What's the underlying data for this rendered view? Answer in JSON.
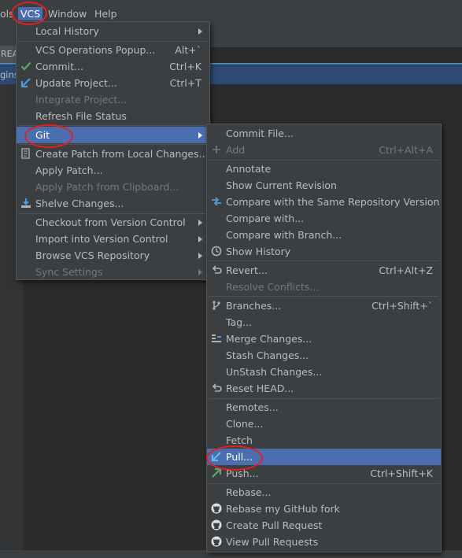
{
  "menubar": {
    "items": [
      "ols",
      "VCS",
      "Window",
      "Help"
    ]
  },
  "background": {
    "tab_text": "REA",
    "row_text": "gins"
  },
  "vcs_menu": {
    "items": [
      {
        "label": "Local History",
        "has_submenu": true
      },
      {
        "label": "VCS Operations Popup...",
        "shortcut": "Alt+`"
      },
      {
        "label": "Commit...",
        "shortcut": "Ctrl+K",
        "icon": "check-icon"
      },
      {
        "label": "Update Project...",
        "shortcut": "Ctrl+T",
        "icon": "update-arrow-icon"
      },
      {
        "label": "Integrate Project...",
        "disabled": true
      },
      {
        "label": "Refresh File Status"
      },
      {
        "label": "Git",
        "has_submenu": true,
        "selected": true
      },
      {
        "label": "Create Patch from Local Changes...",
        "icon": "patch-icon"
      },
      {
        "label": "Apply Patch..."
      },
      {
        "label": "Apply Patch from Clipboard...",
        "disabled": true
      },
      {
        "label": "Shelve Changes...",
        "icon": "shelve-icon"
      },
      {
        "label": "Checkout from Version Control",
        "has_submenu": true
      },
      {
        "label": "Import into Version Control",
        "has_submenu": true
      },
      {
        "label": "Browse VCS Repository",
        "has_submenu": true
      },
      {
        "label": "Sync Settings",
        "has_submenu": true,
        "disabled": true
      }
    ]
  },
  "git_menu": {
    "items": [
      {
        "label": "Commit File..."
      },
      {
        "label": "Add",
        "shortcut": "Ctrl+Alt+A",
        "disabled": true,
        "icon": "plus-icon"
      },
      {
        "label": "Annotate"
      },
      {
        "label": "Show Current Revision"
      },
      {
        "label": "Compare with the Same Repository Version",
        "icon": "compare-icon"
      },
      {
        "label": "Compare with..."
      },
      {
        "label": "Compare with Branch..."
      },
      {
        "label": "Show History",
        "icon": "history-icon"
      },
      {
        "label": "Revert...",
        "shortcut": "Ctrl+Alt+Z",
        "icon": "revert-icon"
      },
      {
        "label": "Resolve Conflicts...",
        "disabled": true
      },
      {
        "label": "Branches...",
        "shortcut": "Ctrl+Shift+`",
        "icon": "branch-icon"
      },
      {
        "label": "Tag..."
      },
      {
        "label": "Merge Changes...",
        "icon": "merge-icon"
      },
      {
        "label": "Stash Changes..."
      },
      {
        "label": "UnStash Changes..."
      },
      {
        "label": "Reset HEAD...",
        "icon": "reset-icon"
      },
      {
        "label": "Remotes..."
      },
      {
        "label": "Clone..."
      },
      {
        "label": "Fetch"
      },
      {
        "label": "Pull...",
        "selected": true,
        "icon": "pull-icon"
      },
      {
        "label": "Push...",
        "shortcut": "Ctrl+Shift+K",
        "icon": "push-icon"
      },
      {
        "label": "Rebase..."
      },
      {
        "label": "Rebase my GitHub fork",
        "icon": "github-icon"
      },
      {
        "label": "Create Pull Request",
        "icon": "github-icon"
      },
      {
        "label": "View Pull Requests",
        "icon": "github-icon"
      }
    ]
  },
  "colors": {
    "menu_bg": "#3c3f41",
    "selection": "#4b6eaf",
    "annotation": "#e02020"
  }
}
